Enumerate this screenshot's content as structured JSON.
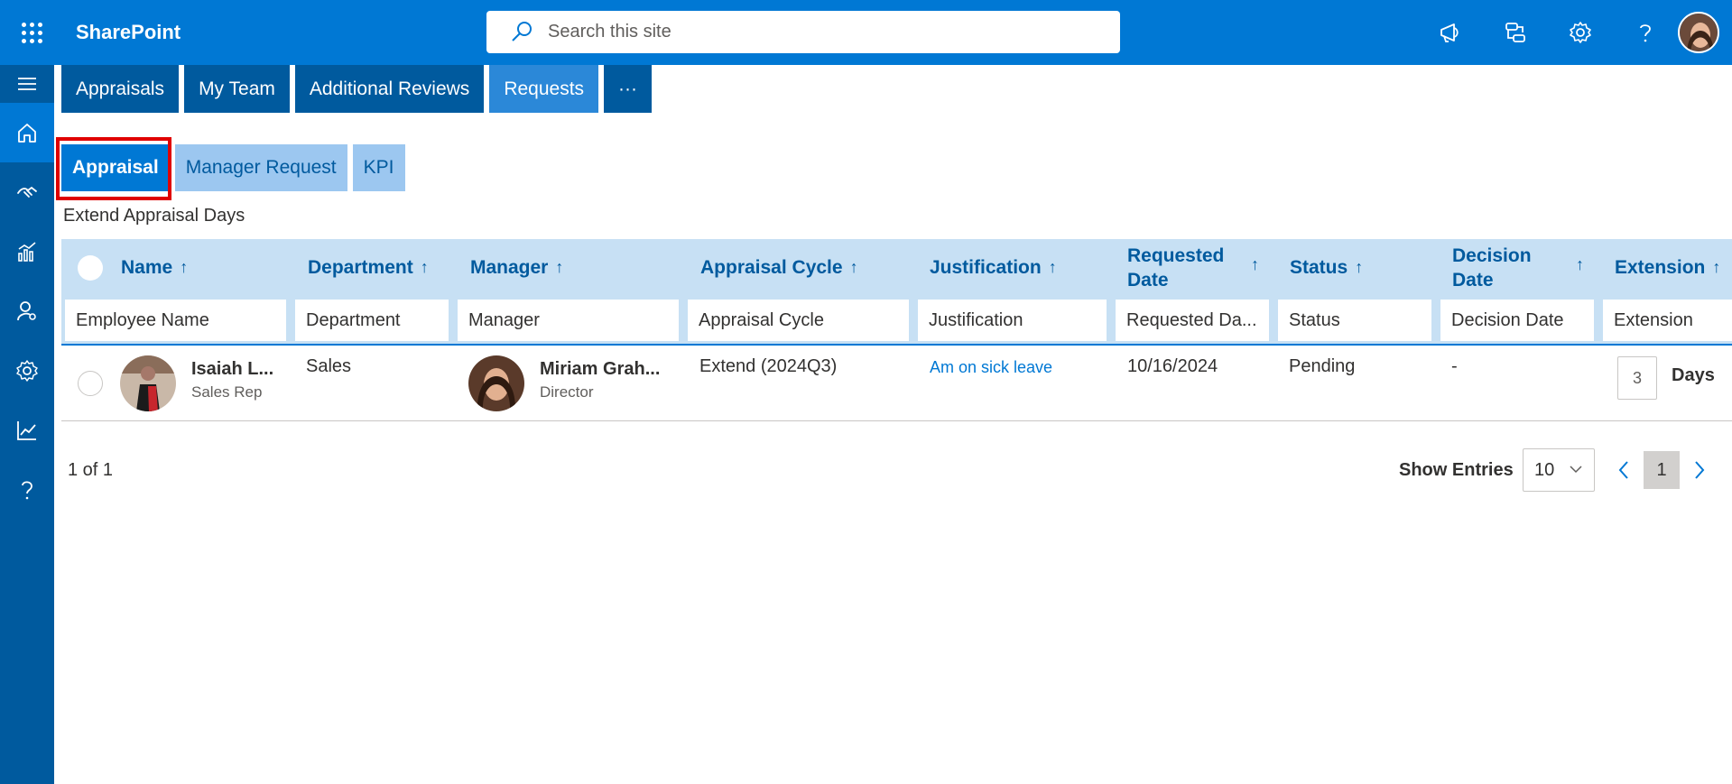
{
  "suite": {
    "app_name": "SharePoint",
    "search_placeholder": "Search this site"
  },
  "tabs": {
    "top": [
      "Appraisals",
      "My Team",
      "Additional Reviews",
      "Requests",
      "···"
    ],
    "active_top": "Requests",
    "sub": [
      "Appraisal",
      "Manager Request",
      "KPI"
    ],
    "active_sub": "Appraisal"
  },
  "section_title": "Extend Appraisal Days",
  "table": {
    "columns": {
      "name": "Name",
      "department": "Department",
      "manager": "Manager",
      "cycle": "Appraisal Cycle",
      "justification": "Justification",
      "requested_1": "Requested",
      "requested_2": "Date",
      "status": "Status",
      "decision_1": "Decision",
      "decision_2": "Date",
      "extension": "Extension"
    },
    "sort_arrow": "↑",
    "filters": {
      "name": "Employee Name",
      "department": "Department",
      "manager": "Manager",
      "cycle": "Appraisal Cycle",
      "justification": "Justification",
      "requested": "Requested Da...",
      "status": "Status",
      "decision": "Decision Date",
      "extension": "Extension"
    },
    "rows": [
      {
        "employee_name": "Isaiah L...",
        "employee_role": "Sales Rep",
        "department": "Sales",
        "manager_name": "Miriam Grah...",
        "manager_role": "Director",
        "cycle": "Extend (2024Q3)",
        "justification": "Am on sick leave",
        "requested_date": "10/16/2024",
        "status": "Pending",
        "decision_date": "-",
        "extension_value": "3",
        "extension_unit": "Days"
      }
    ]
  },
  "footer": {
    "page_info": "1 of 1",
    "show_entries_label": "Show Entries",
    "entries_value": "10",
    "current_page": "1"
  },
  "colors": {
    "suite_bar": "#0078d4",
    "rail": "#005a9e",
    "header_row": "#c7e0f4",
    "tab": "#005a9e",
    "active_tab": "#2b88d8",
    "subtab": "#9cc7f0",
    "highlight": "#e00000"
  }
}
